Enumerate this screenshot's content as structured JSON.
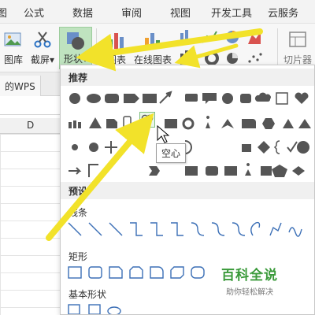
{
  "menu_tabs": [
    "图",
    "公式",
    "数据",
    "审阅",
    "视图",
    "开发工具",
    "云服务"
  ],
  "ribbon": {
    "buttons": [
      "图库",
      "截屏",
      "形状",
      "图表",
      "在线图表",
      "切片器"
    ],
    "dropdown_glyph": "▾"
  },
  "doc_tab": "的WPS",
  "sheet": {
    "column_header": "D"
  },
  "shape_panel": {
    "sections": {
      "recommended": "推荐",
      "preset": "预设"
    },
    "categories": {
      "lines": "线条",
      "rectangles": "矩形",
      "basic_shapes": "基本形状"
    },
    "hovered_shape": "heart-shape",
    "tooltip": "空心"
  },
  "watermark": {
    "title": "百科全说",
    "subtitle": "助你轻松解决"
  },
  "colors": {
    "accent_green": "#3a9a3a",
    "arrow_yellow": "#f2e22a",
    "icon_gray": "#555555",
    "active_bg": "#bfe3bf"
  }
}
